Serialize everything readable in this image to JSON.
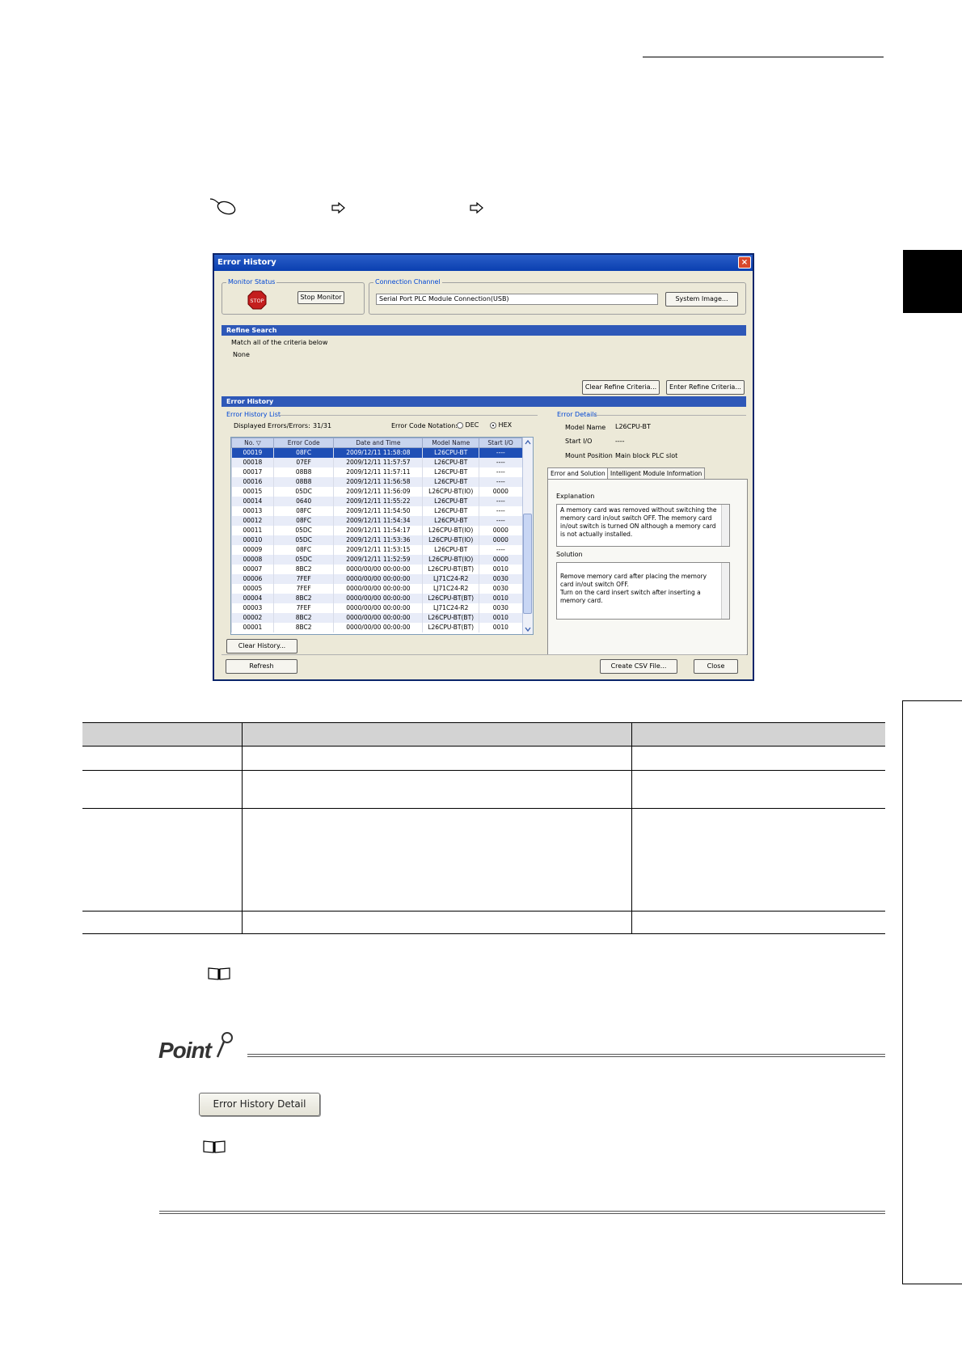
{
  "dialog": {
    "title": "Error History",
    "close_glyph": "×",
    "monitor_status": {
      "label": "Monitor Status",
      "stop_icon_text": "STOP",
      "stop_button": "Stop Monitor"
    },
    "connection": {
      "label": "Connection Channel",
      "value": "Serial Port  PLC Module Connection(USB)",
      "system_image_button": "System Image..."
    },
    "refine": {
      "band": "Refine Search",
      "criteria_line": "Match all of the criteria below",
      "criteria_value": "None",
      "clear_button": "Clear Refine Criteria...",
      "enter_button": "Enter Refine Criteria..."
    },
    "history_band": "Error History",
    "list": {
      "label": "Error History List",
      "displayed_label": "Displayed Errors/Errors:",
      "displayed_value": "31/31",
      "notation_label": "Error Code Notation:",
      "dec_label": "DEC",
      "hex_label": "HEX",
      "headers": [
        "No.",
        "Error Code",
        "Date and Time",
        "Model Name",
        "Start I/O"
      ],
      "sort_glyph": "▽",
      "rows": [
        [
          "00019",
          "08FC",
          "2009/12/11 11:58:08",
          "L26CPU-BT",
          "----"
        ],
        [
          "00018",
          "07EF",
          "2009/12/11 11:57:57",
          "L26CPU-BT",
          "----"
        ],
        [
          "00017",
          "08B8",
          "2009/12/11 11:57:11",
          "L26CPU-BT",
          "----"
        ],
        [
          "00016",
          "08B8",
          "2009/12/11 11:56:58",
          "L26CPU-BT",
          "----"
        ],
        [
          "00015",
          "05DC",
          "2009/12/11 11:56:09",
          "L26CPU-BT(IO)",
          "0000"
        ],
        [
          "00014",
          "0640",
          "2009/12/11 11:55:22",
          "L26CPU-BT",
          "----"
        ],
        [
          "00013",
          "08FC",
          "2009/12/11 11:54:50",
          "L26CPU-BT",
          "----"
        ],
        [
          "00012",
          "08FC",
          "2009/12/11 11:54:34",
          "L26CPU-BT",
          "----"
        ],
        [
          "00011",
          "05DC",
          "2009/12/11 11:54:17",
          "L26CPU-BT(IO)",
          "0000"
        ],
        [
          "00010",
          "05DC",
          "2009/12/11 11:53:36",
          "L26CPU-BT(IO)",
          "0000"
        ],
        [
          "00009",
          "08FC",
          "2009/12/11 11:53:15",
          "L26CPU-BT",
          "----"
        ],
        [
          "00008",
          "05DC",
          "2009/12/11 11:52:59",
          "L26CPU-BT(IO)",
          "0000"
        ],
        [
          "00007",
          "8BC2",
          "0000/00/00 00:00:00",
          "L26CPU-BT(BT)",
          "0010"
        ],
        [
          "00006",
          "7FEF",
          "0000/00/00 00:00:00",
          "LJ71C24-R2",
          "0030"
        ],
        [
          "00005",
          "7FEF",
          "0000/00/00 00:00:00",
          "LJ71C24-R2",
          "0030"
        ],
        [
          "00004",
          "8BC2",
          "0000/00/00 00:00:00",
          "L26CPU-BT(BT)",
          "0010"
        ],
        [
          "00003",
          "7FEF",
          "0000/00/00 00:00:00",
          "LJ71C24-R2",
          "0030"
        ],
        [
          "00002",
          "8BC2",
          "0000/00/00 00:00:00",
          "L26CPU-BT(BT)",
          "0010"
        ],
        [
          "00001",
          "8BC2",
          "0000/00/00 00:00:00",
          "L26CPU-BT(BT)",
          "0010"
        ]
      ]
    },
    "details": {
      "label": "Error Details",
      "model_name_label": "Model Name",
      "model_name_value": "L26CPU-BT",
      "start_io_label": "Start I/O",
      "start_io_value": "----",
      "mount_label": "Mount Position",
      "mount_value": "Main block PLC slot",
      "tab_error": "Error and Solution",
      "tab_module": "Intelligent Module Information",
      "explanation_label": "Explanation",
      "explanation_text": "A memory card was removed without switching the memory card in/out switch OFF.  The memory card in/out switch is turned ON although a memory card is not actually installed.",
      "solution_label": "Solution",
      "solution_text": "Remove memory card after placing the memory card in/out switch OFF.\nTurn on the card insert switch after inserting a memory card."
    },
    "buttons": {
      "clear_history": "Clear History...",
      "refresh": "Refresh",
      "create_csv": "Create CSV File...",
      "close": "Close"
    }
  },
  "inline_button": "Error History Detail",
  "point_logo": "Point"
}
